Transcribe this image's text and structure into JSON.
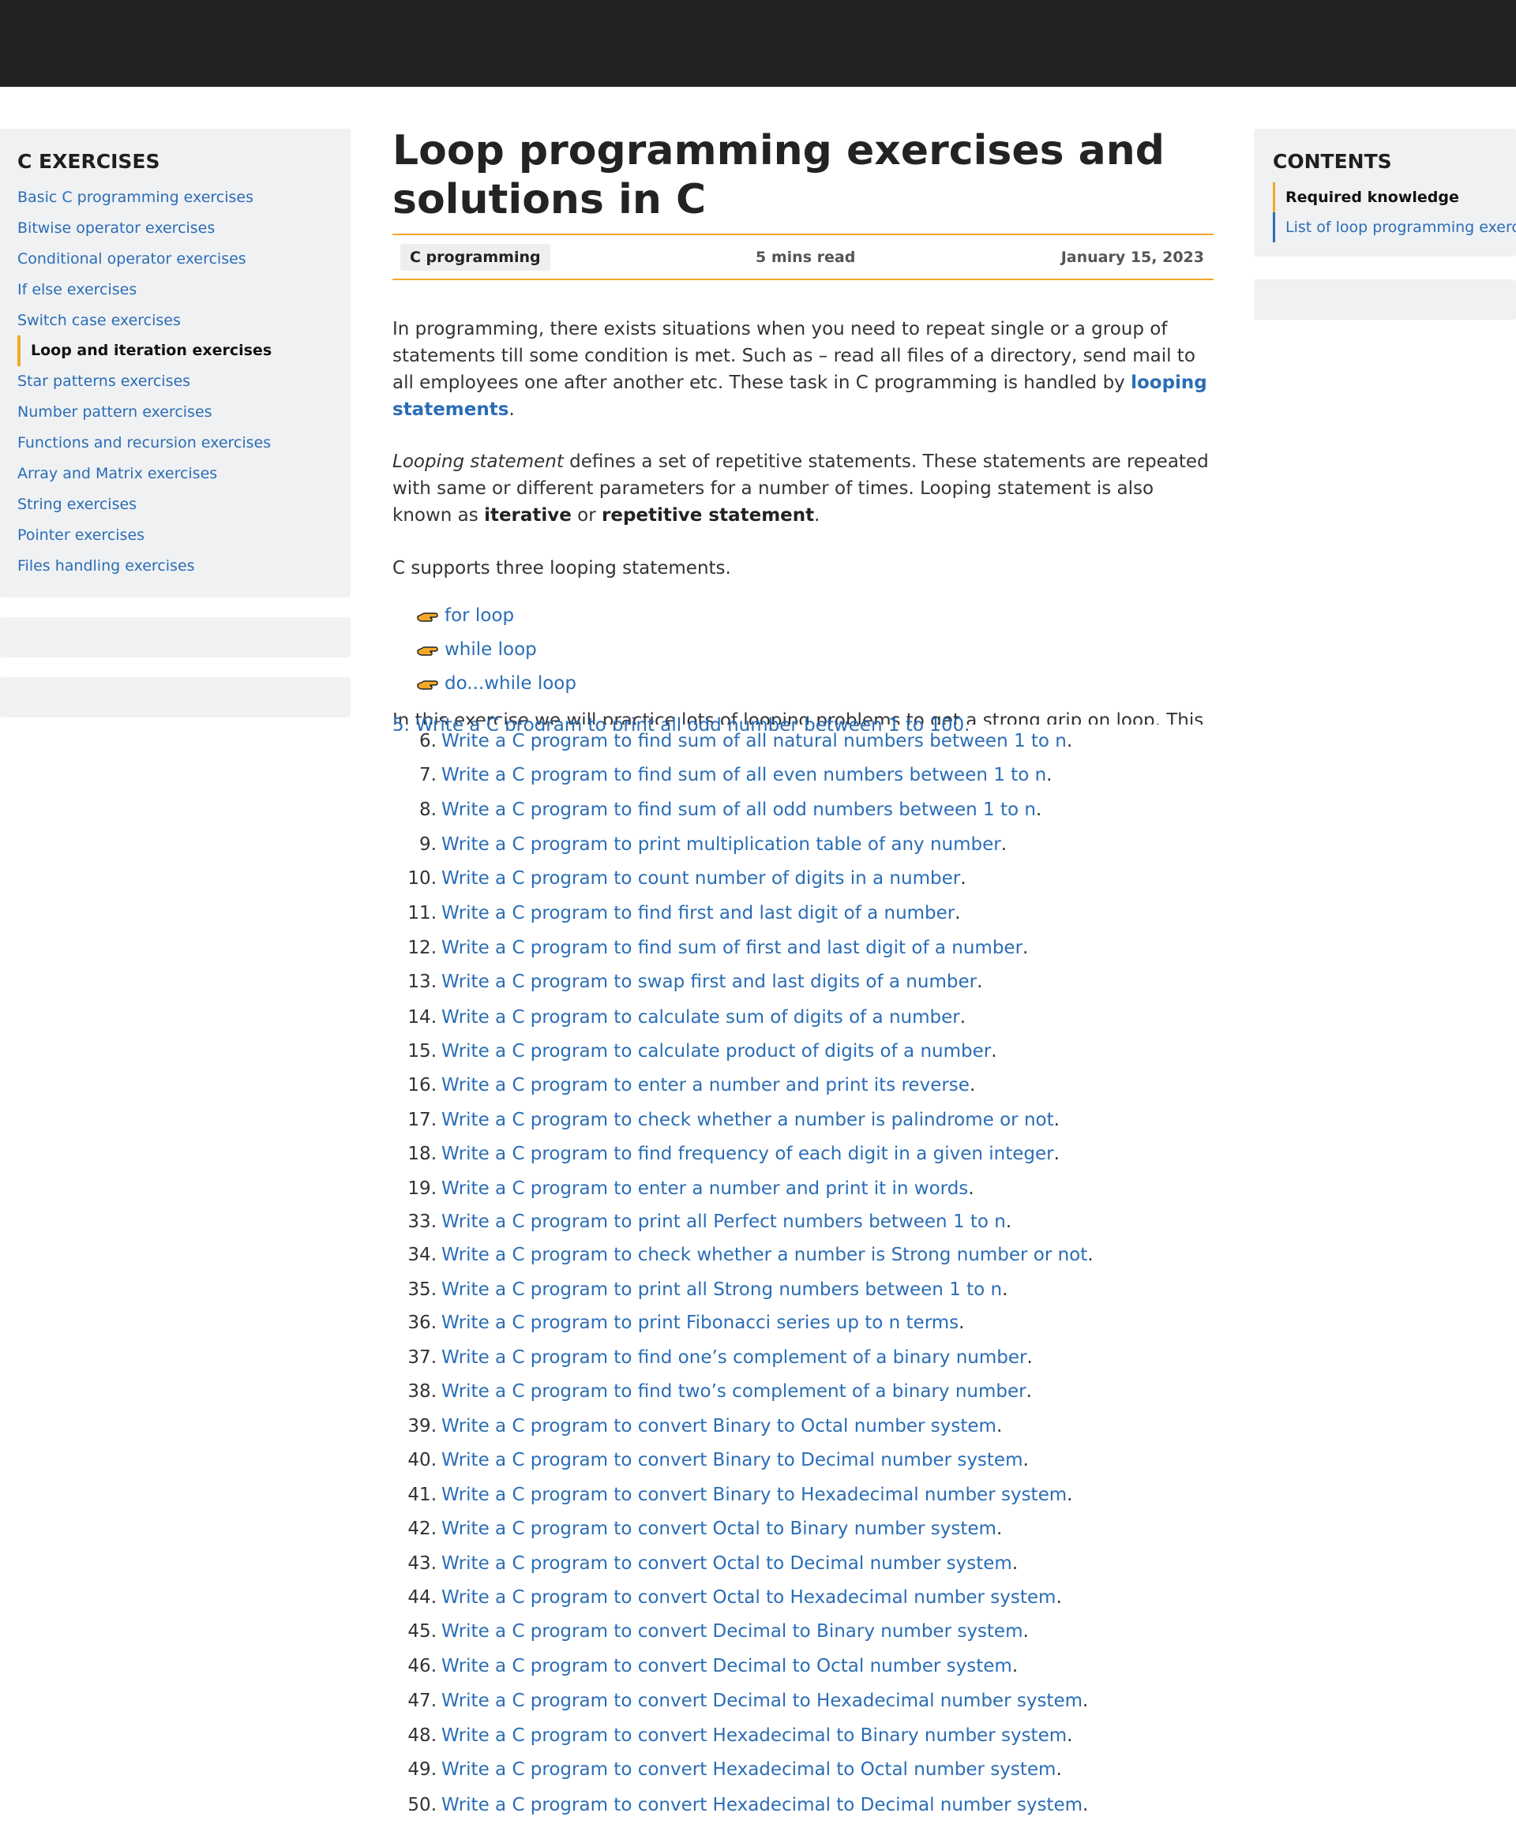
{
  "sidebar": {
    "title": "C EXERCISES",
    "items": [
      {
        "label": "Basic C programming exercises"
      },
      {
        "label": "Bitwise operator exercises"
      },
      {
        "label": "Conditional operator exercises"
      },
      {
        "label": "If else exercises"
      },
      {
        "label": "Switch case exercises"
      },
      {
        "label": "Loop and iteration exercises"
      },
      {
        "label": "Star patterns exercises"
      },
      {
        "label": "Number pattern exercises"
      },
      {
        "label": "Functions and recursion exercises"
      },
      {
        "label": "Array and Matrix exercises"
      },
      {
        "label": "String exercises"
      },
      {
        "label": "Pointer exercises"
      },
      {
        "label": "Files handling exercises"
      }
    ]
  },
  "toc": {
    "title": "CONTENTS",
    "items": [
      {
        "label": "Required knowledge"
      },
      {
        "label": "List of loop programming exercis"
      }
    ]
  },
  "article": {
    "title_line1": "Loop programming exercises and",
    "title_line2": "solutions in C",
    "tag": "C programming",
    "read_time": "5 mins read",
    "date": "January 15, 2023",
    "p1_text": "In programming, there exists situations when you need to repeat single or a group of statements till some condition is met. Such as – read all files of a directory, send mail to all employees one after another etc. These task in C programming is handled by ",
    "p1_link": "looping statements",
    "p1_end": ".",
    "p2_italic": "Looping statement",
    "p2_text": " defines a set of repetitive statements. These statements are repeated with same or different parameters for a number of times. Looping statement is also known as ",
    "p2_bold1": "iterative",
    "p2_or": " or ",
    "p2_bold2": "repetitive statement",
    "p2_end": ".",
    "p3": "C supports three looping statements.",
    "loops": [
      "for loop",
      "while loop",
      "do...while loop"
    ],
    "clipped_text": "In this exercise we will practice lots of looping problems to get a strong grip on loop. This is most",
    "ghost_item": "5. Write a C program to print all odd number between 1 to 100."
  },
  "exercises": [
    {
      "num": "6.",
      "text": "Write a C program to find sum of all natural numbers between 1 to n."
    },
    {
      "num": "7.",
      "text": "Write a C program to find sum of all even numbers between 1 to n."
    },
    {
      "num": "8.",
      "text": "Write a C program to find sum of all odd numbers between 1 to n."
    },
    {
      "num": "9.",
      "text": "Write a C program to print multiplication table of any number."
    },
    {
      "num": "10.",
      "text": "Write a C program to count number of digits in a number."
    },
    {
      "num": "11.",
      "text": "Write a C program to find first and last digit of a number."
    },
    {
      "num": "12.",
      "text": "Write a C program to find sum of first and last digit of a number."
    },
    {
      "num": "13.",
      "text": "Write a C program to swap first and last digits of a number."
    },
    {
      "num": "14.",
      "text": "Write a C program to calculate sum of digits of a number."
    },
    {
      "num": "15.",
      "text": "Write a C program to calculate product of digits of a number."
    },
    {
      "num": "16.",
      "text": "Write a C program to enter a number and print its reverse."
    },
    {
      "num": "17.",
      "text": "Write a C program to check whether a number is palindrome or not."
    },
    {
      "num": "18.",
      "text": "Write a C program to find frequency of each digit in a given integer."
    },
    {
      "num": "19.",
      "text": "Write a C program to enter a number and print it in words."
    },
    {
      "num": "33.",
      "text": "Write a C program to print all Perfect numbers between 1 to n."
    },
    {
      "num": "34.",
      "text": "Write a C program to check whether a number is Strong number or not."
    },
    {
      "num": "35.",
      "text": "Write a C program to print all Strong numbers between 1 to n."
    },
    {
      "num": "36.",
      "text": "Write a C program to print Fibonacci series up to n terms."
    },
    {
      "num": "37.",
      "text": "Write a C program to find one’s complement of a binary number."
    },
    {
      "num": "38.",
      "text": "Write a C program to find two’s complement of a binary number."
    },
    {
      "num": "39.",
      "text": "Write a C program to convert Binary to Octal number system."
    },
    {
      "num": "40.",
      "text": "Write a C program to convert Binary to Decimal number system."
    },
    {
      "num": "41.",
      "text": "Write a C program to convert Binary to Hexadecimal number system."
    },
    {
      "num": "42.",
      "text": "Write a C program to convert Octal to Binary number system."
    },
    {
      "num": "43.",
      "text": "Write a C program to convert Octal to Decimal number system."
    },
    {
      "num": "44.",
      "text": "Write a C program to convert Octal to Hexadecimal number system."
    },
    {
      "num": "45.",
      "text": "Write a C program to convert Decimal to Binary number system."
    },
    {
      "num": "46.",
      "text": "Write a C program to convert Decimal to Octal number system."
    },
    {
      "num": "47.",
      "text": "Write a C program to convert Decimal to Hexadecimal number system."
    },
    {
      "num": "48.",
      "text": "Write a C program to convert Hexadecimal to Binary number system."
    },
    {
      "num": "49.",
      "text": "Write a C program to convert Hexadecimal to Octal number system."
    },
    {
      "num": "50.",
      "text": "Write a C program to convert Hexadecimal to Decimal number system."
    }
  ],
  "colors": {
    "accent": "#f4a829",
    "link": "#2a6db5",
    "topbar": "#232323",
    "panel": "#f0f1f3"
  },
  "icons": {
    "loop_bullet": "pointing-hand-icon"
  }
}
